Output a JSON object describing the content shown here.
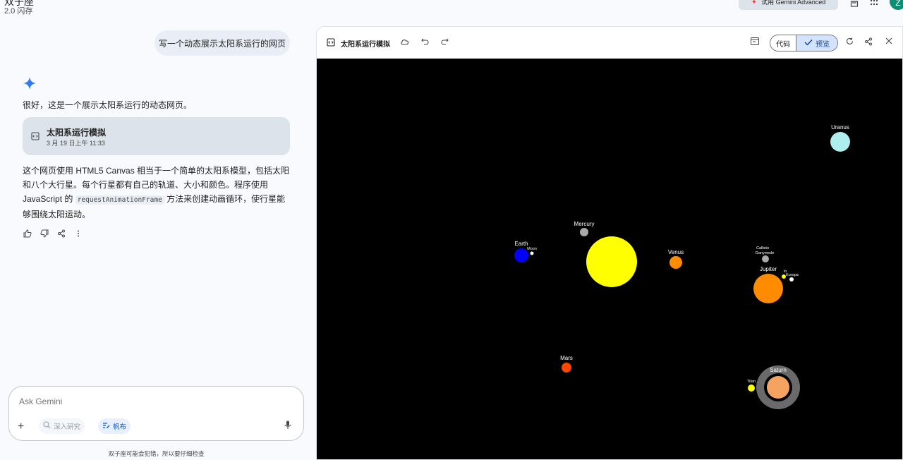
{
  "app": {
    "title": "双子座",
    "model": "2.0 闪存",
    "upgrade_label": "试用 Gemini Advanced",
    "avatar_letter": "Z"
  },
  "chat": {
    "user_message": "写一个动态展示太阳系运行的网页",
    "response_intro": "很好，这是一个展示太阳系运行的动态网页。",
    "artifact": {
      "title": "太阳系运行模拟",
      "timestamp": "3 月 19 日上午 11:33"
    },
    "response_body_1": "这个网页使用 HTML5 Canvas 相当于一个简单的太阳系模型，包括太阳和八个大行星。每个行星都有自己的轨道、大小和颜色。程序使用 JavaScript 的",
    "response_code": "requestAnimationFrame",
    "response_body_2": "方法来创建动画循环，使行星能够围绕太阳运动。"
  },
  "input": {
    "placeholder": "Ask Gemini",
    "research_label": "深入研究",
    "canvas_label": "帆布",
    "disclaimer": "双子座可能会犯错，所以要仔细检查"
  },
  "panel": {
    "title": "太阳系运行模拟",
    "code_label": "代码",
    "preview_label": "预览"
  },
  "bodies": [
    {
      "name": "",
      "color": "#ffff00"
    },
    {
      "name": "Mercury",
      "color": "#a9a9a9"
    },
    {
      "name": "Venus",
      "color": "#ff8c00"
    },
    {
      "name": "Earth",
      "color": "#0000ff"
    },
    {
      "name": "Moon",
      "color": "#ffffff"
    },
    {
      "name": "Mars",
      "color": "#ff4500"
    },
    {
      "name": "Jupiter",
      "color": "#ff8c00"
    },
    {
      "name": "Io",
      "color": "#ffff00"
    },
    {
      "name": "Europa",
      "color": "#ffffff"
    },
    {
      "name": "Ganymede",
      "color": "#a9a9a9"
    },
    {
      "name": "Callisto",
      "color": "#a9a9a9"
    },
    {
      "name": "Saturn",
      "color": "#f4a460"
    },
    {
      "name": "Titan",
      "color": "#ffff00"
    },
    {
      "name": "Uranus",
      "color": "#afeeee"
    }
  ]
}
